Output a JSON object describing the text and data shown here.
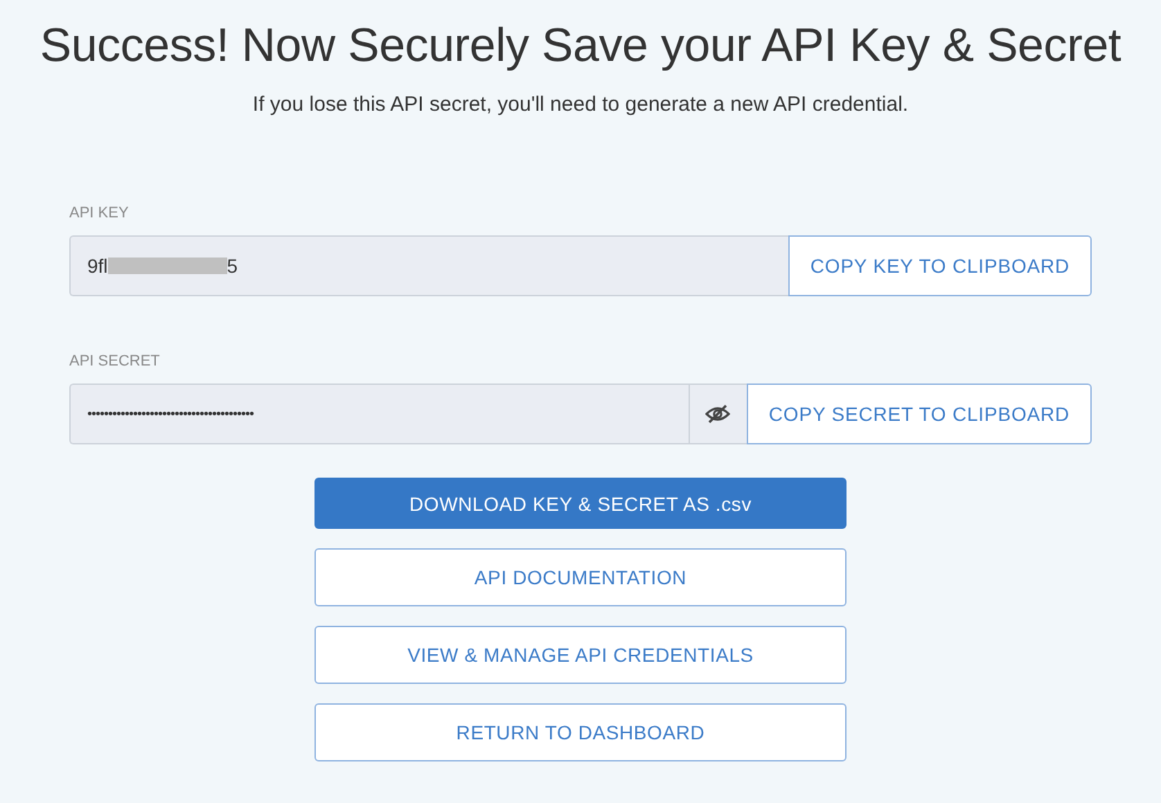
{
  "title": "Success! Now Securely Save your API Key & Secret",
  "subtitle": "If you lose this API secret, you'll need to generate a new API credential.",
  "api_key": {
    "label": "API KEY",
    "value_start": "9fl",
    "value_end": "5",
    "redacted": true,
    "button": "COPY KEY TO CLIPBOARD"
  },
  "api_secret": {
    "label": "API SECRET",
    "value": "••••••••••••••••••••••••••••••••••••••••",
    "hidden": true,
    "button": "COPY SECRET TO CLIPBOARD"
  },
  "actions": [
    {
      "label": "DOWNLOAD KEY & SECRET AS .csv",
      "kind": "primary"
    },
    {
      "label": "API DOCUMENTATION",
      "kind": "outline"
    },
    {
      "label": "VIEW & MANAGE API CREDENTIALS",
      "kind": "outline"
    },
    {
      "label": "RETURN TO DASHBOARD",
      "kind": "outline"
    }
  ]
}
